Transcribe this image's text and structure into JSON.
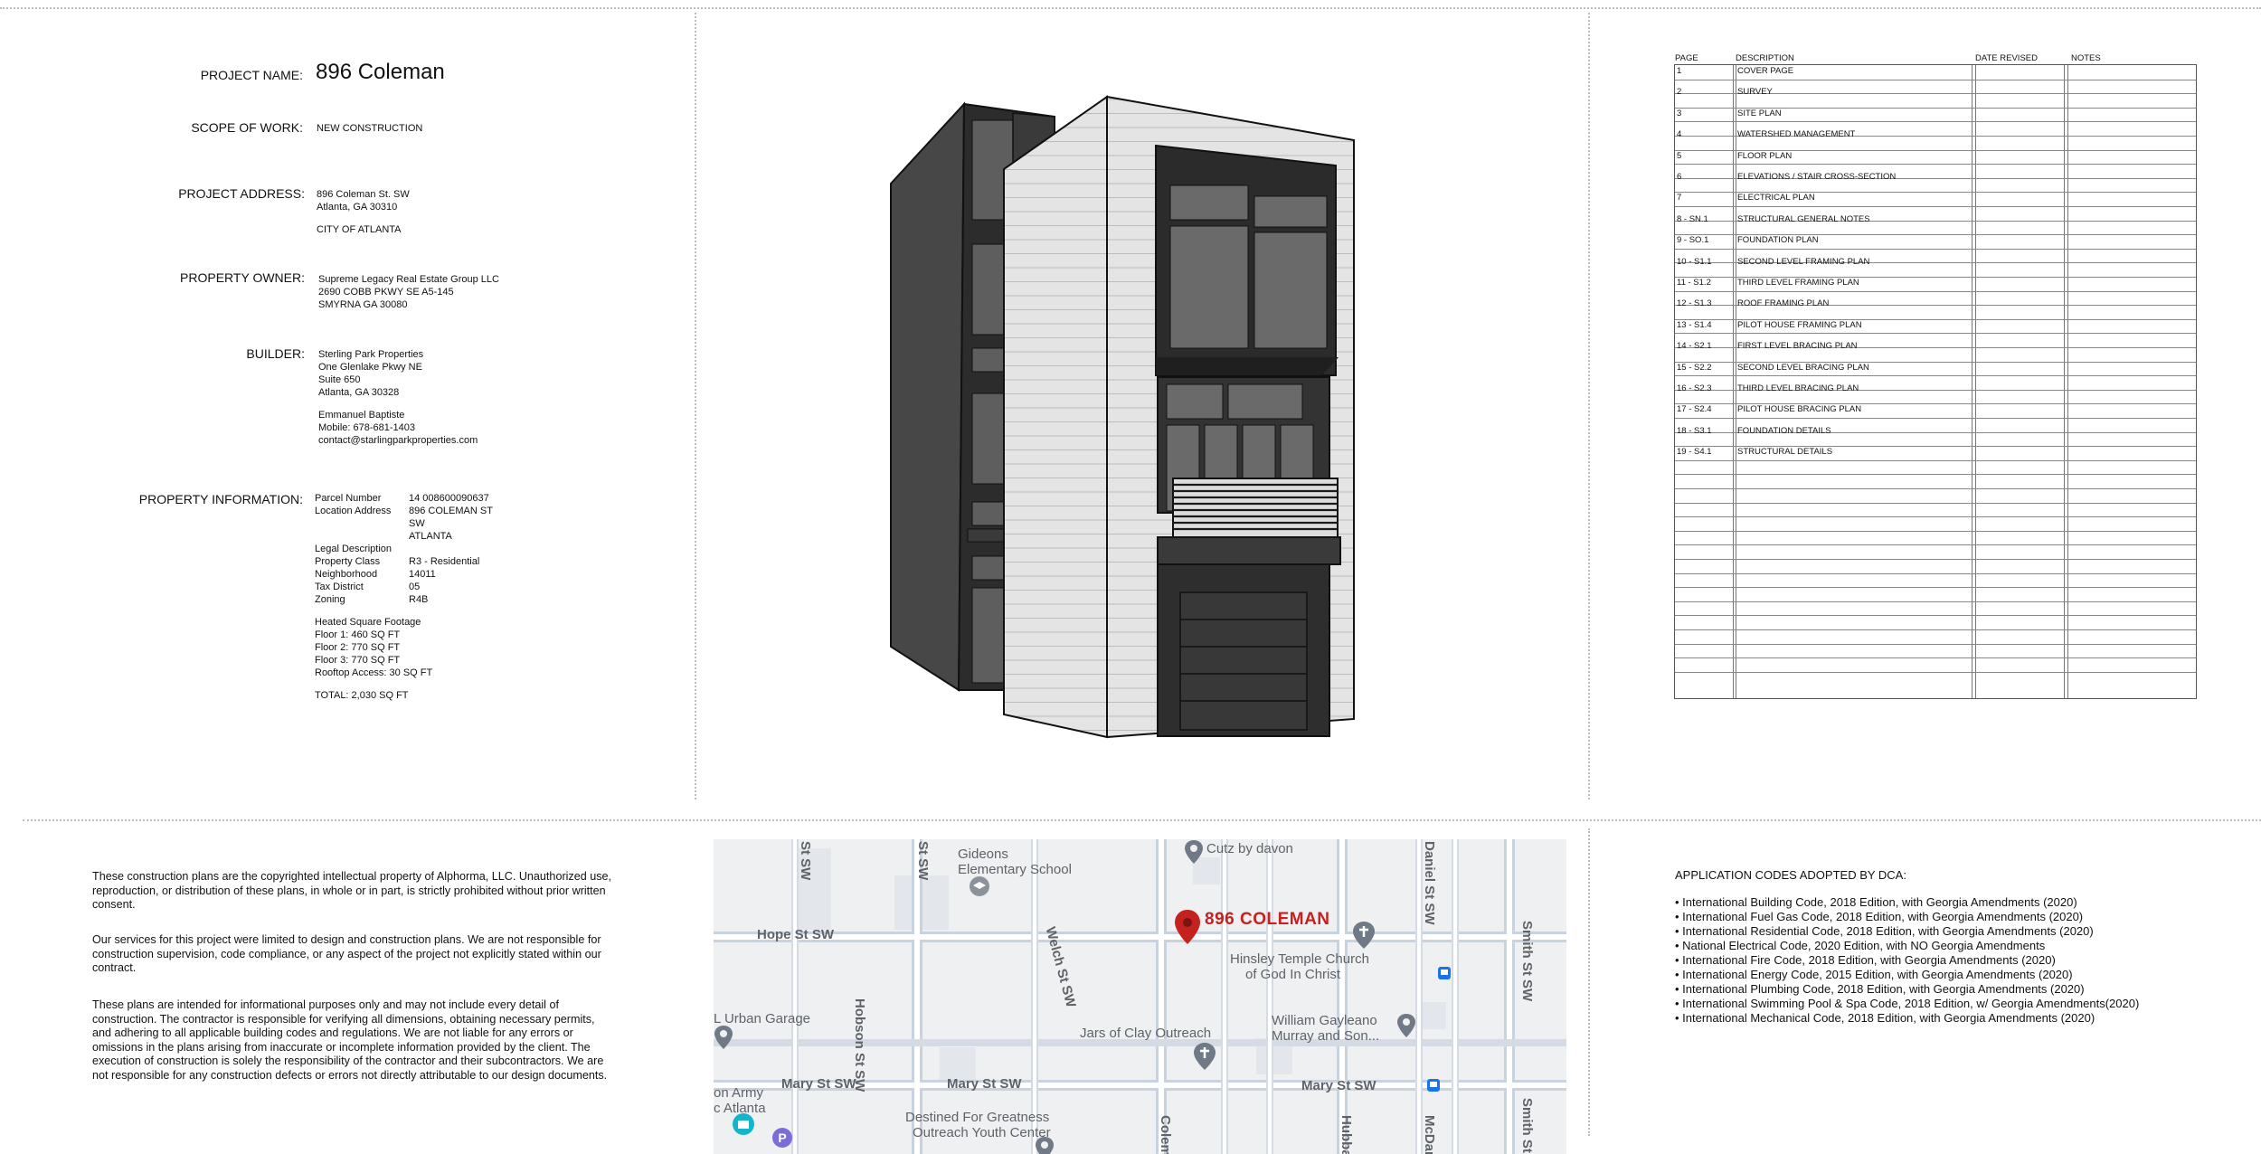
{
  "project": {
    "name_label": "PROJECT NAME:",
    "name": "896 Coleman",
    "scope_label": "SCOPE OF WORK:",
    "scope": "NEW CONSTRUCTION",
    "address_label": "PROJECT ADDRESS:",
    "address_line1": "896 Coleman St. SW",
    "address_line2": "Atlanta, GA 30310",
    "city": "CITY OF ATLANTA",
    "owner_label": "PROPERTY OWNER:",
    "owner_line1": "Supreme Legacy Real Estate Group LLC",
    "owner_line2": "2690 COBB PKWY SE A5-145",
    "owner_line3": "SMYRNA GA 30080",
    "builder_label": "BUILDER:",
    "builder_line1": "Sterling Park Properties",
    "builder_line2": "One Glenlake Pkwy NE",
    "builder_line3": "Suite 650",
    "builder_line4": "Atlanta, GA 30328",
    "contact_name": "Emmanuel Baptiste",
    "contact_mobile": "Mobile: 678-681-1403",
    "contact_email": "contact@starlingparkproperties.com",
    "info_label": "PROPERTY INFORMATION:",
    "info_rows": [
      {
        "k": "Parcel Number",
        "v": "14 008600090637"
      },
      {
        "k": "Location Address",
        "v": "896 COLEMAN ST"
      },
      {
        "k": "",
        "v": "SW"
      },
      {
        "k": "",
        "v": "ATLANTA"
      },
      {
        "k": "Legal Description",
        "v": ""
      },
      {
        "k": "Property Class",
        "v": "R3 - Residential"
      },
      {
        "k": "Neighborhood",
        "v": "14011"
      },
      {
        "k": "Tax District",
        "v": "05"
      },
      {
        "k": "Zoning",
        "v": "R4B"
      }
    ],
    "sqft_title": "Heated Square Footage",
    "sqft_floor1": "Floor 1: 460 SQ FT",
    "sqft_floor2": "Floor 2: 770 SQ FT",
    "sqft_floor3": "Floor 3: 770 SQ FT",
    "sqft_rooftop": "Rooftop Access: 30 SQ FT",
    "sqft_total": "TOTAL: 2,030 SQ FT"
  },
  "sheet_index": {
    "headers": {
      "page": "PAGE",
      "description": "DESCRIPTION",
      "date_revised": "DATE REVISED",
      "notes": "NOTES"
    },
    "rows": [
      {
        "page": "1",
        "desc": "COVER PAGE"
      },
      {
        "page": "2",
        "desc": "SURVEY"
      },
      {
        "page": "3",
        "desc": "SITE PLAN"
      },
      {
        "page": "4",
        "desc": "WATERSHED MANAGEMENT"
      },
      {
        "page": "5",
        "desc": "FLOOR PLAN"
      },
      {
        "page": "6",
        "desc": "ELEVATIONS / STAIR CROSS-SECTION"
      },
      {
        "page": "7",
        "desc": "ELECTRICAL PLAN"
      },
      {
        "page": "8 - SN.1",
        "desc": "STRUCTURAL GENERAL NOTES"
      },
      {
        "page": "9 - SO.1",
        "desc": "FOUNDATION PLAN"
      },
      {
        "page": "10 - S1.1",
        "desc": "SECOND LEVEL FRAMING PLAN"
      },
      {
        "page": "11 - S1.2",
        "desc": "THIRD LEVEL FRAMING PLAN"
      },
      {
        "page": "12 - S1.3",
        "desc": "ROOF FRAMING PLAN"
      },
      {
        "page": "13 - S1.4",
        "desc": "PILOT HOUSE FRAMING PLAN"
      },
      {
        "page": "14 - S2.1",
        "desc": "FIRST LEVEL BRACING PLAN"
      },
      {
        "page": "15 - S2.2",
        "desc": "SECOND LEVEL BRACING PLAN"
      },
      {
        "page": "16 - S2.3",
        "desc": "THIRD LEVEL BRACING PLAN"
      },
      {
        "page": "17 - S2.4",
        "desc": "PILOT HOUSE BRACING PLAN"
      },
      {
        "page": "18 - S3.1",
        "desc": "FOUNDATION DETAILS"
      },
      {
        "page": "19 - S4.1",
        "desc": "STRUCTURAL DETAILS"
      }
    ]
  },
  "notes": {
    "p1": "These construction plans are the copyrighted intellectual property of Alphorma, LLC. Unauthorized use, reproduction, or distribution of these plans, in whole or in part, is strictly prohibited without prior written consent.",
    "p2": "Our services for this project were limited to design and construction plans. We are not responsible for construction supervision, code compliance, or any aspect of the project not explicitly stated within our contract.",
    "p3": "These plans are intended for informational purposes only and may not include every detail of construction. The contractor is responsible for verifying all dimensions, obtaining necessary permits, and adhering to all applicable building codes and regulations. We are not liable for any errors or omissions in the plans arising from inaccurate or incomplete information provided by the client. The execution of construction is solely the responsibility of the contractor and their subcontractors. We are not responsible for any construction defects or errors not directly attributable to our design documents."
  },
  "codes": {
    "title": "APPLICATION CODES ADOPTED BY DCA:",
    "items": [
      "• International Building Code, 2018 Edition, with Georgia Amendments (2020)",
      "• International Fuel Gas Code, 2018 Edition, with Georgia Amendments (2020)",
      "• International Residential Code, 2018 Edition, with Georgia Amendments (2020)",
      "• National Electrical Code, 2020 Edition, with NO Georgia Amendments",
      "• International Fire Code, 2018 Edition, with Georgia Amendments (2020)",
      "• International Energy Code, 2015 Edition, with Georgia Amendments (2020)",
      "• International Plumbing Code, 2018 Edition, with Georgia Amendments (2020)",
      "• International Swimming Pool & Spa Code, 2018 Edition, w/ Georgia Amendments(2020)",
      "• International Mechanical Code, 2018 Edition, with Georgia Amendments (2020)"
    ]
  },
  "map": {
    "pin_label": "896 COLEMAN",
    "pin_color": "#c5221f",
    "places": {
      "cutz": "Cutz by davon",
      "gideons1": "Gideons",
      "gideons2": "Elementary School",
      "hinsley1": "Hinsley Temple Church",
      "hinsley2": "of God In Christ",
      "urban_garage": "L Urban Garage",
      "jars": "Jars of Clay Outreach",
      "william1": "William Gayleano",
      "william2": "Murray and Son...",
      "army1": "on Army",
      "army2": "c Atlanta",
      "destined1": "Destined For Greatness",
      "destined2": "Outreach Youth Center"
    },
    "streets": {
      "hope": "Hope St SW",
      "mary_left": "Mary St SW",
      "mary_mid": "Mary St SW",
      "mary_right": "Mary St SW",
      "hobson": "Hobson St SW",
      "welch": "Welch St SW",
      "daniel": "Daniel St SW",
      "smith_top": "Smith St SW",
      "smith_bottom": "Smith St",
      "st_sw_a": "St SW",
      "st_sw_b": "St SW",
      "colem": "Colem",
      "hubba": "Hubba",
      "mcdan": "McDan"
    }
  }
}
